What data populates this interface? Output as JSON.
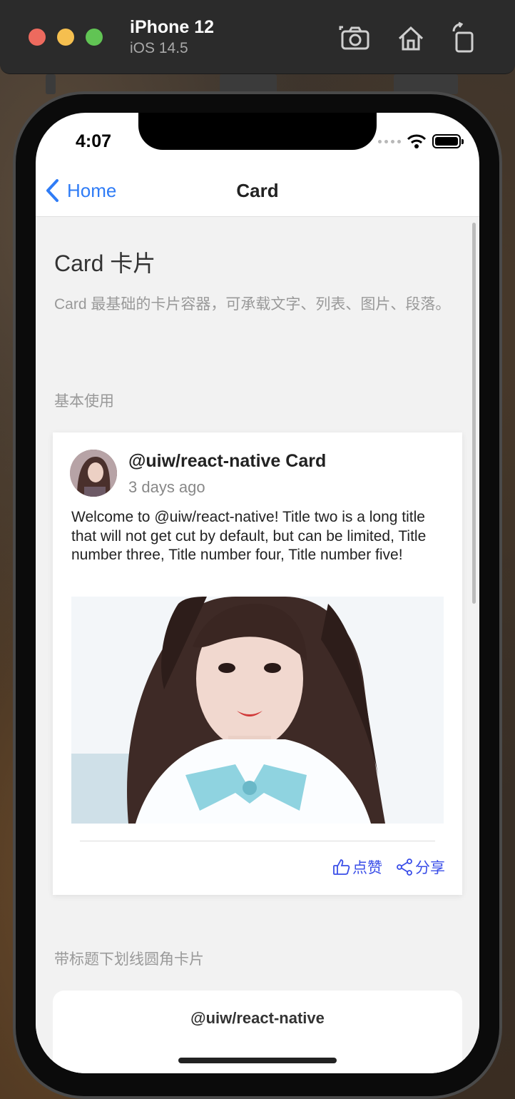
{
  "simulator": {
    "device": "iPhone 12",
    "os": "iOS 14.5"
  },
  "status_bar": {
    "time": "4:07"
  },
  "navbar": {
    "back_label": "Home",
    "title": "Card"
  },
  "page": {
    "title": "Card 卡片",
    "description": "Card 最基础的卡片容器，可承载文字、列表、图片、段落。"
  },
  "sections": [
    {
      "label": "基本使用",
      "card": {
        "name": "@uiw/react-native Card",
        "time": "3 days ago",
        "body": "Welcome to @uiw/react-native! Title two is a long title that will not get cut by default, but can be limited, Title number three, Title number four, Title number five!",
        "actions": [
          {
            "icon": "thumbs-up-icon",
            "label": "点赞"
          },
          {
            "icon": "share-icon",
            "label": "分享"
          }
        ]
      }
    },
    {
      "label": "带标题下划线圆角卡片",
      "card": {
        "title": "@uiw/react-native"
      }
    }
  ]
}
